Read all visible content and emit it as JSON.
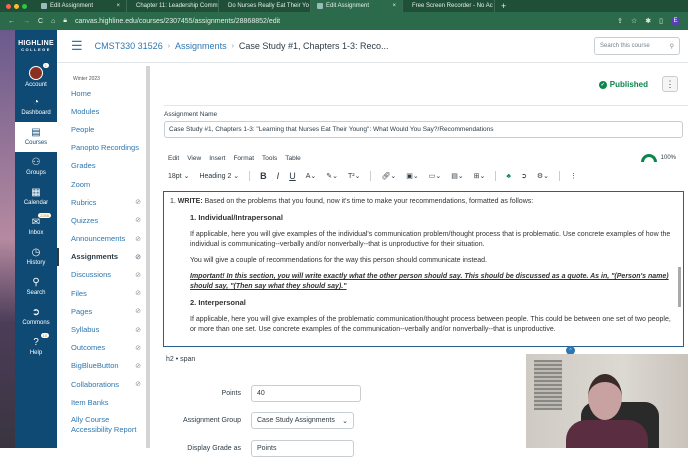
{
  "browser": {
    "tabs": [
      {
        "label": "Edit Assignment",
        "active": false
      },
      {
        "label": "Chapter 11: Leadership Comm",
        "active": false
      },
      {
        "label": "Do Nurses Really Eat Their Yo",
        "active": false
      },
      {
        "label": "Edit Assignment",
        "active": true
      },
      {
        "label": "Free Screen Recorder - No Ac",
        "active": false
      }
    ],
    "url": "canvas.highline.edu/courses/2307455/assignments/28868852/edit",
    "profile_initial": "E"
  },
  "rail": {
    "logo": "HIGHLINE",
    "logo_sub": "COLLEGE",
    "items": [
      {
        "label": "Account",
        "badge": "1"
      },
      {
        "label": "Dashboard"
      },
      {
        "label": "Courses"
      },
      {
        "label": "Groups"
      },
      {
        "label": "Calendar"
      },
      {
        "label": "Inbox",
        "badge": "2256"
      },
      {
        "label": "History"
      },
      {
        "label": "Search"
      },
      {
        "label": "Commons"
      },
      {
        "label": "Help",
        "badge": "10"
      }
    ]
  },
  "header": {
    "breadcrumb": [
      "CMST330 31526",
      "Assignments",
      "Case Study #1, Chapters 1-3: Reco..."
    ],
    "search_placeholder": "Search this course"
  },
  "course_nav": {
    "term": "Winter 2023",
    "items": [
      {
        "label": "Home",
        "hidden": false
      },
      {
        "label": "Modules",
        "hidden": false
      },
      {
        "label": "People",
        "hidden": false
      },
      {
        "label": "Panopto Recordings",
        "hidden": false
      },
      {
        "label": "Grades",
        "hidden": false
      },
      {
        "label": "Zoom",
        "hidden": false
      },
      {
        "label": "Rubrics",
        "hidden": true
      },
      {
        "label": "Quizzes",
        "hidden": true
      },
      {
        "label": "Announcements",
        "hidden": true
      },
      {
        "label": "Assignments",
        "hidden": true,
        "active": true
      },
      {
        "label": "Discussions",
        "hidden": true
      },
      {
        "label": "Files",
        "hidden": true
      },
      {
        "label": "Pages",
        "hidden": true
      },
      {
        "label": "Syllabus",
        "hidden": true
      },
      {
        "label": "Outcomes",
        "hidden": true
      },
      {
        "label": "BigBlueButton",
        "hidden": true
      },
      {
        "label": "Collaborations",
        "hidden": true
      },
      {
        "label": "Item Banks",
        "hidden": false
      }
    ],
    "last_item": "Ally Course Accessibility Report"
  },
  "main": {
    "status": "Published",
    "name_label": "Assignment Name",
    "name_value": "Case Study #1, Chapters 1-3: \"Learning that Nurses Eat Their Young\": What Would You Say?/Recommendations",
    "menu": [
      "Edit",
      "View",
      "Insert",
      "Format",
      "Tools",
      "Table"
    ],
    "zoom": "100%",
    "font_size": "18pt",
    "block_format": "Heading 2",
    "content": {
      "intro_bold": "WRITE:",
      "intro": " Based on the problems that you found, now it's time to make your recommendations, formatted as follows:",
      "h1": "1. Individual/Intrapersonal",
      "p1": "If applicable, here you will give examples of the individual's communication problem/thought process that is problematic. Use concrete examples of how the individual is communicating--verbally and/or nonverbally--that is unproductive for their situation.",
      "p2": "You will give a couple of recommendations for the way this person should communicate instead.",
      "important": "Important! In this section, you will write exactly what the other person should say. This should be discussed as a quote. As in, \"(Person's name) should say, \"(Then say what they should say).\"",
      "h2": "2. Interpersonal",
      "p3": "If applicable, here you will give examples of the problematic communication/thought process between people. This could be between one set of two people, or more than one set. Use concrete examples of the communication--verbally and/or nonverbally--that is unproductive."
    },
    "element_path": "h2 • span",
    "points_label": "Points",
    "points_value": "40",
    "group_label": "Assignment Group",
    "group_value": "Case Study Assignments",
    "display_label": "Display Grade as",
    "display_value": "Points"
  }
}
